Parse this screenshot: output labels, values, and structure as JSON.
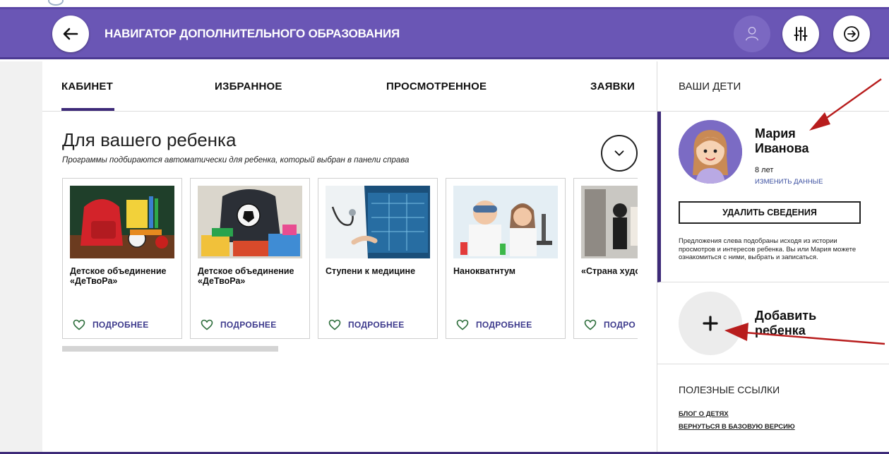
{
  "header": {
    "title": "НАВИГАТОР ДОПОЛНИТЕЛЬНОГО ОБРАЗОВАНИЯ",
    "back_icon": "arrow-left-icon",
    "user_icon": "user-icon",
    "filters_icon": "sliders-icon",
    "exit_icon": "arrow-right-circle-icon",
    "brand_color": "#6a56b5"
  },
  "tabs": [
    {
      "label": "КАБИНЕТ",
      "active": true
    },
    {
      "label": "ИЗБРАННОЕ",
      "active": false
    },
    {
      "label": "ПРОСМОТРЕННОЕ",
      "active": false
    },
    {
      "label": "ЗАЯВКИ",
      "active": false
    }
  ],
  "main": {
    "title": "Для вашего ребенка",
    "subtitle": "Программы подбираются автоматически для ребенка, который выбран в панели справа",
    "collapse_icon": "chevron-down-icon",
    "cards": [
      {
        "name": "Детское объединение «ДеТвоРа»",
        "more": "ПОДРОБНЕЕ",
        "image": "school-backpack-photo"
      },
      {
        "name": "Детское объединение «ДеТвоРа»",
        "more": "ПОДРОБНЕЕ",
        "image": "soccer-backpack-photo"
      },
      {
        "name": "Ступени к медицине",
        "more": "ПОДРОБНЕЕ",
        "image": "doctor-photo"
      },
      {
        "name": "Нанокватнтум",
        "more": "ПОДРОБНЕЕ",
        "image": "kids-lab-photo"
      },
      {
        "name": "«Страна художнико",
        "more": "ПОДРО",
        "image": "art-class-photo"
      }
    ]
  },
  "right_panel": {
    "heading": "ВАШИ ДЕТИ",
    "child": {
      "first_name": "Мария",
      "last_name": "Иванова",
      "age": "8 лет",
      "edit_label": "ИЗМЕНИТЬ ДАННЫЕ",
      "delete_label": "УДАЛИТЬ СВЕДЕНИЯ",
      "note": "Предложения слева подобраны исходя из истории просмотров и интересов ребенка. Вы или Мария можете ознакомиться с ними, выбрать и записаться."
    },
    "add_child": {
      "label_line1": "Добавить",
      "label_line2": "ребенка",
      "icon": "plus-icon"
    },
    "links": {
      "heading": "ПОЛЕЗНЫЕ ССЫЛКИ",
      "items": [
        "БЛОГ О ДЕТЯХ",
        "ВЕРНУТЬСЯ В БАЗОВУЮ ВЕРСИЮ"
      ]
    }
  },
  "accent_color": "#3d2a78",
  "annotation_color": "#b81d1d"
}
